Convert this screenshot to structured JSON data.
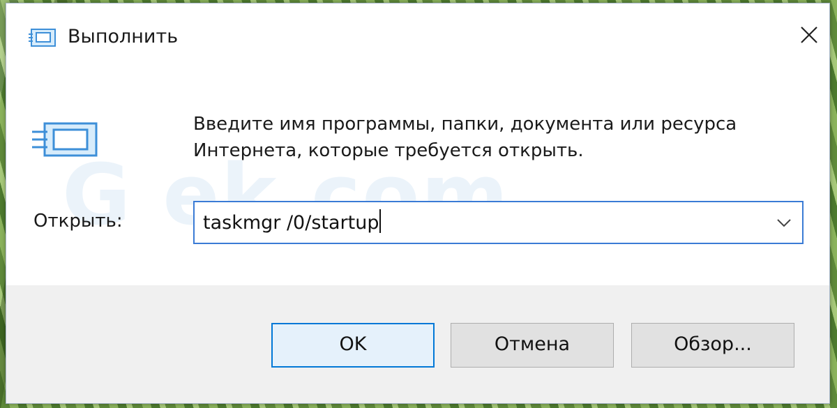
{
  "window": {
    "title": "Выполнить",
    "title_icon": "run-icon",
    "close_icon": "close-icon"
  },
  "watermark": "G ek.com",
  "description": "Введите имя программы, папки, документа или ресурса Интернета, которые требуется открыть.",
  "open": {
    "label": "Открыть:",
    "value": "taskmgr /0/startup",
    "dropdown_icon": "chevron-down-icon"
  },
  "buttons": {
    "ok": "OK",
    "cancel": "Отмена",
    "browse": "Обзор..."
  },
  "colors": {
    "accent": "#0078d7",
    "footer_bg": "#f0f0f0",
    "icon_blue": "#3d8fd8"
  }
}
